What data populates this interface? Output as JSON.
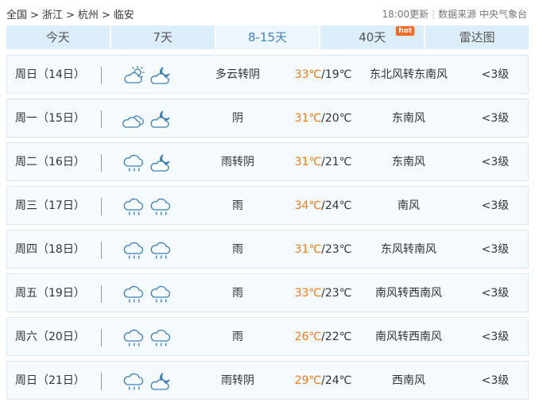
{
  "breadcrumb": {
    "items": [
      "全国",
      "浙江",
      "杭州",
      "临安"
    ],
    "separator": ">"
  },
  "meta": {
    "update": "18:00更新",
    "source": "数据来源 中央气象台"
  },
  "tabs": [
    {
      "label": "今天",
      "active": false
    },
    {
      "label": "7天",
      "active": false
    },
    {
      "label": "8-15天",
      "active": true
    },
    {
      "label": "40天",
      "active": false,
      "badge": "hot"
    },
    {
      "label": "雷达图",
      "active": false
    }
  ],
  "colors": {
    "accent": "#3a86c8",
    "high_temp": "#f07a16",
    "hot_badge": "#f66a24",
    "icon_stroke": "#3a7fb8"
  },
  "days": [
    {
      "day": "周日（14日）",
      "icons": [
        "partly-cloudy-day-icon",
        "cloudy-night-icon"
      ],
      "weather": "多云转阴",
      "high": "33℃",
      "low": "/19℃",
      "wind": "东北风转东南风",
      "level": "<3级"
    },
    {
      "day": "周一（15日）",
      "icons": [
        "overcast-icon",
        "cloudy-night-icon"
      ],
      "weather": "阴",
      "high": "31℃",
      "low": "/20℃",
      "wind": "东南风",
      "level": "<3级"
    },
    {
      "day": "周二（16日）",
      "icons": [
        "rain-icon",
        "cloudy-night-icon"
      ],
      "weather": "雨转阴",
      "high": "31℃",
      "low": "/21℃",
      "wind": "东南风",
      "level": "<3级"
    },
    {
      "day": "周三（17日）",
      "icons": [
        "rain-icon",
        "rain-icon"
      ],
      "weather": "雨",
      "high": "34℃",
      "low": "/24℃",
      "wind": "南风",
      "level": "<3级"
    },
    {
      "day": "周四（18日）",
      "icons": [
        "rain-icon",
        "rain-icon"
      ],
      "weather": "雨",
      "high": "31℃",
      "low": "/23℃",
      "wind": "东风转南风",
      "level": "<3级"
    },
    {
      "day": "周五（19日）",
      "icons": [
        "rain-icon",
        "rain-icon"
      ],
      "weather": "雨",
      "high": "33℃",
      "low": "/23℃",
      "wind": "南风转西南风",
      "level": "<3级"
    },
    {
      "day": "周六（20日）",
      "icons": [
        "rain-icon",
        "rain-icon"
      ],
      "weather": "雨",
      "high": "26℃",
      "low": "/22℃",
      "wind": "南风转西南风",
      "level": "<3级"
    },
    {
      "day": "周日（21日）",
      "icons": [
        "rain-icon",
        "cloudy-night-icon"
      ],
      "weather": "雨转阴",
      "high": "29℃",
      "low": "/24℃",
      "wind": "西南风",
      "level": "<3级"
    }
  ]
}
